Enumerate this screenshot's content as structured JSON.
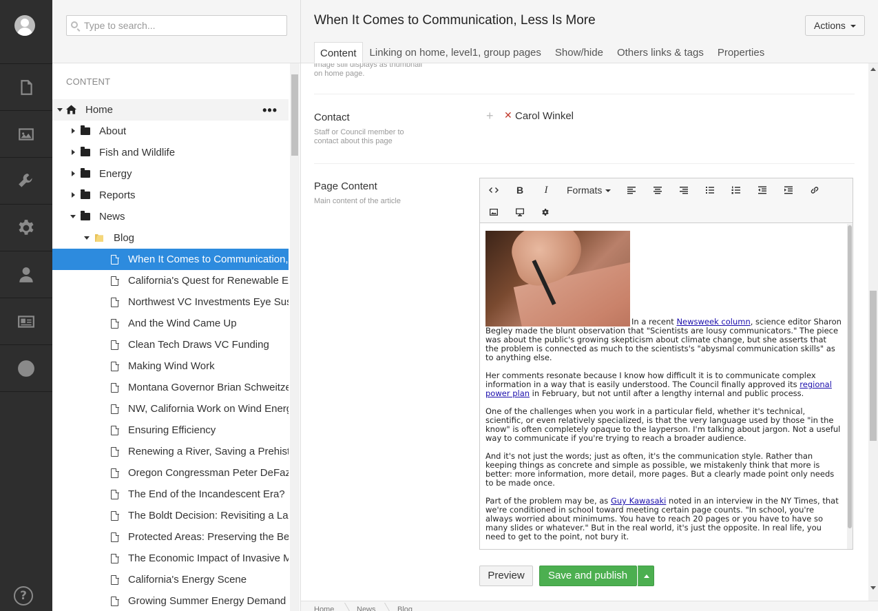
{
  "sidebar_nav": {
    "items": [
      {
        "icon": "pages-icon"
      },
      {
        "icon": "images-icon"
      },
      {
        "icon": "wrench-icon"
      },
      {
        "icon": "gear-icon"
      },
      {
        "icon": "user-icon"
      },
      {
        "icon": "id-card-icon"
      },
      {
        "icon": "globe-icon"
      }
    ],
    "help_label": "?"
  },
  "tree": {
    "search_placeholder": "Type to search...",
    "section_title": "CONTENT",
    "home_label": "Home",
    "home_menu": "•••",
    "folders": [
      "About",
      "Fish and Wildlife",
      "Energy",
      "Reports",
      "News"
    ],
    "blog_label": "Blog",
    "pages": [
      "When It Comes to Communication, Less Is More",
      "California's Quest for Renewable Energy",
      "Northwest VC Investments Eye Sustainability",
      "And the Wind Came Up",
      "Clean Tech Draws VC Funding",
      "Making Wind Work",
      "Montana Governor Brian Schweitzer",
      "NW, California Work on Wind Energy",
      "Ensuring Efficiency",
      "Renewing a River, Saving a Prehistoric",
      "Oregon Congressman Peter DeFazio",
      "The End of the Incandescent Era?",
      "The Boldt Decision: Revisiting a Landmark",
      "Protected Areas: Preserving the Best",
      "The Economic Impact of Invasive Mussels",
      "California's Energy Scene",
      "Growing Summer Energy Demand"
    ]
  },
  "main": {
    "title": "When It Comes to Communication, Less Is More",
    "actions_label": "Actions",
    "tabs": [
      "Content",
      "Linking on home, level1, group pages",
      "Show/hide",
      "Others links & tags",
      "Properties"
    ],
    "top_help": "image still displays as thumbnail on home page.",
    "contact": {
      "label": "Contact",
      "desc": "Staff or Council member to contact about this page",
      "value": "Carol Winkel"
    },
    "page_content": {
      "label": "Page Content",
      "desc": "Main content of the article",
      "formats_label": "Formats"
    },
    "article": {
      "p1_a": "In a recent ",
      "p1_link": "Newsweek column",
      "p1_b": ", science editor Sharon Begley made the blunt observation that \"Scientists are lousy communicators.\" The piece was about the public's growing skepticism about climate change, but she asserts that the problem is connected as much to the scientists's \"abysmal communication skills\" as to anything else.",
      "p2_a": "Her comments resonate because I know how difficult it is to communicate complex information in a way that is easily understood. The Council finally approved its ",
      "p2_link": "regional power plan",
      "p2_b": " in February, but not until after a lengthy internal and public process.",
      "p3": "One of the challenges when you work in a particular field, whether it's technical, scientific, or even relatively specialized, is that the very language used by those \"in the know\" is often completely opaque to the layperson. I'm talking about jargon. Not a useful way to communicate if you're trying to reach a broader audience.",
      "p4": "And it's not just the words; just as often, it's the communication style. Rather than keeping things as concrete and simple as possible, we mistakenly think that more is better: more information, more detail, more pages. But a clearly made point only needs to be made once.",
      "p5_a": "Part of the problem may be, as ",
      "p5_link": "Guy Kawasaki",
      "p5_b": " noted in an interview in the NY Times, that we're conditioned in school toward meeting certain page counts. \"In school, you're always worried about minimums. You have to reach 20 pages or you have to have so many slides or whatever.\" But in the real world, it's just the opposite. In real life, you need to get to the point, not bury it."
    },
    "preview_label": "Preview",
    "publish_label": "Save and publish",
    "breadcrumbs": [
      "Home",
      "News",
      "Blog"
    ]
  },
  "colors": {
    "sidebar_bg": "#2e2e2e",
    "selected_bg": "#2d8bde",
    "publish_green": "#4caf50"
  }
}
